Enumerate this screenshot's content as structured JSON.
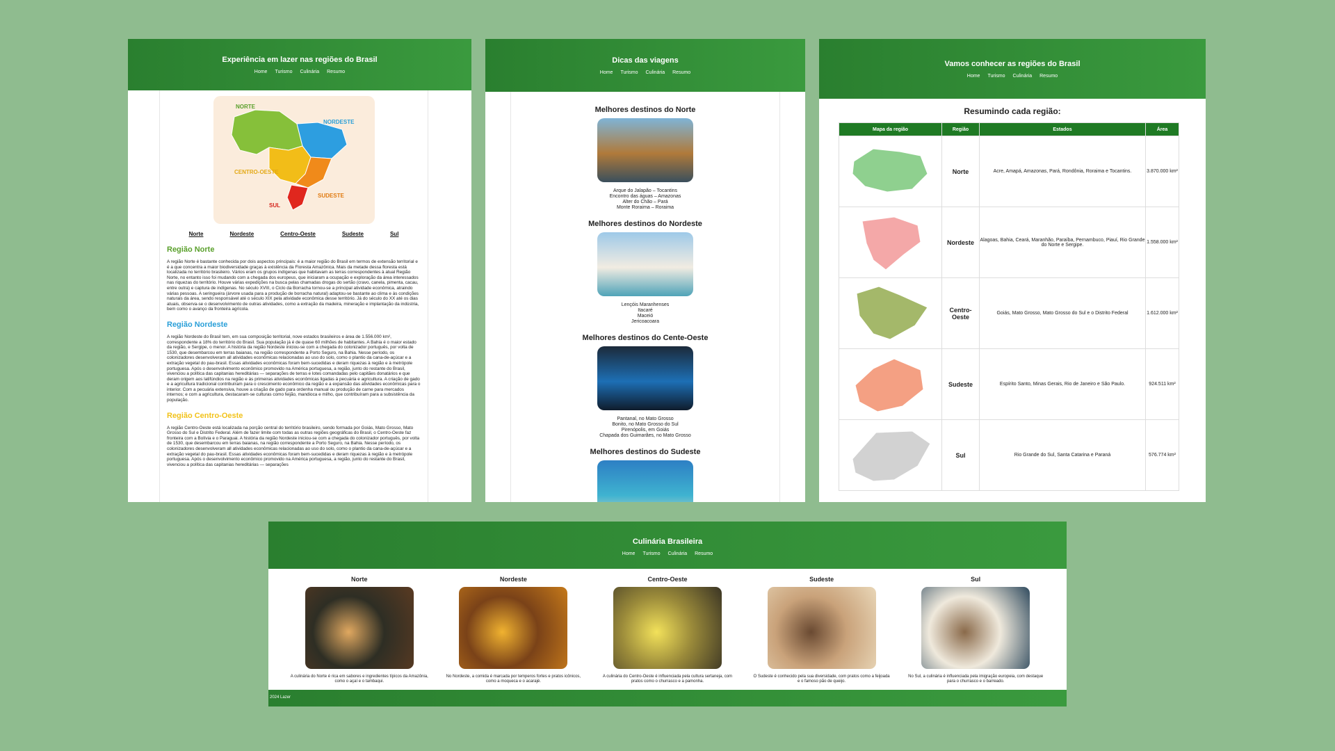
{
  "nav": [
    "Home",
    "Turismo",
    "Culinária",
    "Resumo"
  ],
  "lazer": {
    "title": "Experiência em lazer nas regiões do Brasil",
    "map_labels": {
      "norte": "NORTE",
      "nordeste": "NORDESTE",
      "centro_oeste": "CENTRO-OESTE",
      "sudeste": "SUDESTE",
      "sul": "SUL"
    },
    "region_links": [
      "Norte",
      "Nordeste",
      "Centro-Oeste",
      "Sudeste",
      "Sul"
    ],
    "sections": [
      {
        "title": "Região Norte",
        "color": "#5aa02c",
        "text": "A região Norte é bastante conhecida por dois aspectos principais: é a maior região do Brasil em termos de extensão territorial e é a que concentra a maior biodiversidade graças à existência da Floresta Amazônica. Mais da metade dessa floresta está localizada no território brasileiro. Vários eram os grupos indígenas que habitavam as terras correspondentes à atual Região Norte, no entanto isso foi mudando com a chegada dos europeus, que iniciaram a ocupação e exploração da área interessados nas riquezas do território. Houve várias expedições na busca pelas chamadas drogas do sertão (cravo, canela, pimenta, cacau, entre outra) e captura de indígenas. No século XVIII, o Ciclo da Borracha tornou-se a principal atividade econômica, atraindo várias pessoas. A seringueira (árvore usada para a produção de borracha natural) adaptou-se bastante ao clima e às condições naturais da área, sendo responsável até o século XIX pela atividade econômica desse território. Já do século do XX até os dias atuais, observa-se o desenvolvimento de outras atividades, como a extração da madeira, mineração e implantação da indústria, bem como o avanço da fronteira agrícola."
      },
      {
        "title": "Região Nordeste",
        "color": "#2a9fd8",
        "text": "A região Nordeste do Brasil tem, em sua composição territorial, nove estados brasileiros e área de 1.556.000 km², correspondente a 18% do território do Brasil. Sua população já é de quase 60 milhões de habitantes. A Bahia é o maior estado da região, e Sergipe, o menor. A história da região Nordeste iniciou-se com a chegada do colonizador português, por volta de 1530, que desembarcou em terras baianas, na região correspondente a Porto Seguro, na Bahia. Nesse período, os colonizadores desenvolveram all atividades econômicas relacionadas ao uso do solo, como o plantio da cana-de-açúcar e a extração vegetal do pau-brasil. Essas atividades econômicas foram bem-sucedidas e deram riquezas à região e à metrópole portuguesa. Após o desenvolvimento econômico promovido na América portuguesa, a região, junto do restante do Brasil, vivenciou a política das capitanias hereditárias — separações de terras e lotes comandadas pelo capitães donatários e que deram origem aos latifúndios na região e às primeiras atividades econômicas ligadas à pecuária e agricultura. A criação de gado e a agricultura tradicional contribuíram para o crescimento econômico da região e a expansão das atividades econômicas para o interior. Com a pecuária extensiva, houve a criação de gado para ordenha manual ou produção de carne para mercados internos; e com a agricultura, destacaram-se culturas como feijão, mandioca e milho, que contribuíram para a subsistência da população."
      },
      {
        "title": "Região Centro-Oeste",
        "color": "#f2c21a",
        "text": "A região Centro-Oeste está localizada na porção central do território brasileiro, sendo formada por Goiás, Mato Grosso, Mato Grosso do Sul e Distrito Federal. Além de fazer limite com todas as outras regiões geográficas do Brasil, o Centro-Oeste faz fronteira com a Bolívia e o Paraguai. A história da região Nordeste iniciou-se com a chegada do colonizador português, por volta de 1530, que desembarcou em terras baianas, na região correspondente a Porto Seguro, na Bahia. Nesse período, os colonizadores desenvolveram all atividades econômicas relacionadas ao uso do solo, como o plantio da cana-de-açúcar e a extração vegetal do pau-brasil. Essas atividades econômicas foram bem-sucedidas e deram riquezas à região e à metrópole portuguesa. Após o desenvolvimento econômico promovido na América portuguesa, a região, junto do restante do Brasil, vivenciou a política das capitanias hereditárias — separações"
      }
    ]
  },
  "dicas": {
    "title": "Dicas das viagens",
    "destinations": [
      {
        "title": "Melhores destinos do Norte",
        "lines": [
          "Arque do Jalapão – Tocantins",
          "Encontro das águas – Amazonas",
          "Alter do Chão – Pará",
          "Monte Roraima – Roraima"
        ],
        "colors": [
          "#7fb4d6",
          "#b07a3a",
          "#3a4f5c"
        ]
      },
      {
        "title": "Melhores destinos do Nordeste",
        "lines": [
          "Lençóis Maranhenses",
          "Itacaré",
          "Maceió",
          "Jericoacoara"
        ],
        "colors": [
          "#9ec9e8",
          "#f1ece2",
          "#4fa3b8"
        ]
      },
      {
        "title": "Melhores destinos do Cente-Oeste",
        "lines": [
          "Pantanal, no Mato Grosso",
          "Bonito, no Mato Grosso do Sul",
          "Pirenópolis, em Goiás",
          "Chapada dos Guimarães, no Mato Grosso"
        ],
        "colors": [
          "#1c2a3a",
          "#1d6fb5",
          "#0f1c2c"
        ]
      },
      {
        "title": "Melhores destinos do Sudeste",
        "lines": [],
        "colors": [
          "#2d7fc4",
          "#3fb3d0",
          "#e9ddc6"
        ]
      }
    ]
  },
  "resumo": {
    "title": "Vamos conhecer as regiões do Brasil",
    "heading": "Resumindo cada região:",
    "headers": [
      "Mapa da região",
      "Região",
      "Estados",
      "Área"
    ],
    "rows": [
      {
        "region": "Norte",
        "states": "Acre, Amapá, Amazonas, Pará, Rondônia, Roraima e Tocantins.",
        "area": "3.870.000 km²",
        "map_color": "#8fd08f"
      },
      {
        "region": "Nordeste",
        "states": "Alagoas, Bahia, Ceará, Maranhão, Paraíba, Pernambuco, Piauí, Rio Grande do Norte e Sergipe.",
        "area": "1.558.000 km²",
        "map_color": "#f4a8a8"
      },
      {
        "region": "Centro-Oeste",
        "states": "Goiás, Mato Grosso, Mato Grosso do Sul e o Distrito Federal",
        "area": "1.612.000 km²",
        "map_color": "#a4b86a"
      },
      {
        "region": "Sudeste",
        "states": "Espírito Santo, Minas Gerais, Rio de Janeiro e São Paulo.",
        "area": "924.511 km²",
        "map_color": "#f4a083"
      },
      {
        "region": "Sul",
        "states": "Rio Grande do Sul, Santa Catarina e Paraná",
        "area": "576.774 km²",
        "map_color": "#d2d2d2"
      }
    ]
  },
  "culinaria": {
    "title": "Culinária Brasileira",
    "cards": [
      {
        "region": "Norte",
        "text": "A culinária do Norte é rica em sabores e ingredientes típicos da Amazônia, como o açaí e o tambaqui.",
        "colors": [
          "#5a3a22",
          "#e0a860",
          "#2e2e24"
        ]
      },
      {
        "region": "Nordeste",
        "text": "No Nordeste, a comida é marcada por temperos fortes e pratos icônicos, como a moqueca e o acarajé.",
        "colors": [
          "#c67a1a",
          "#f0b230",
          "#7a4218"
        ]
      },
      {
        "region": "Centro-Oeste",
        "text": "A culinária do Centro-Oeste é influenciada pela cultura sertaneja, com pratos como o churrasco e a pamonha.",
        "colors": [
          "#3a3424",
          "#f2e15a",
          "#9a8a3a"
        ]
      },
      {
        "region": "Sudeste",
        "text": "O Sudeste é conhecido pela sua diversidade, com pratos como a feijoada e o famoso pão de queijo.",
        "colors": [
          "#e9d7b8",
          "#6a4a32",
          "#c9a27a"
        ]
      },
      {
        "region": "Sul",
        "text": "No Sul, a culinária é influenciada pela imigração europeia, com destaque para o churrasco e o barreado.",
        "colors": [
          "#2f4a5e",
          "#8a6a4a",
          "#efe9dc"
        ]
      }
    ],
    "footer": "2024 Lazer"
  }
}
